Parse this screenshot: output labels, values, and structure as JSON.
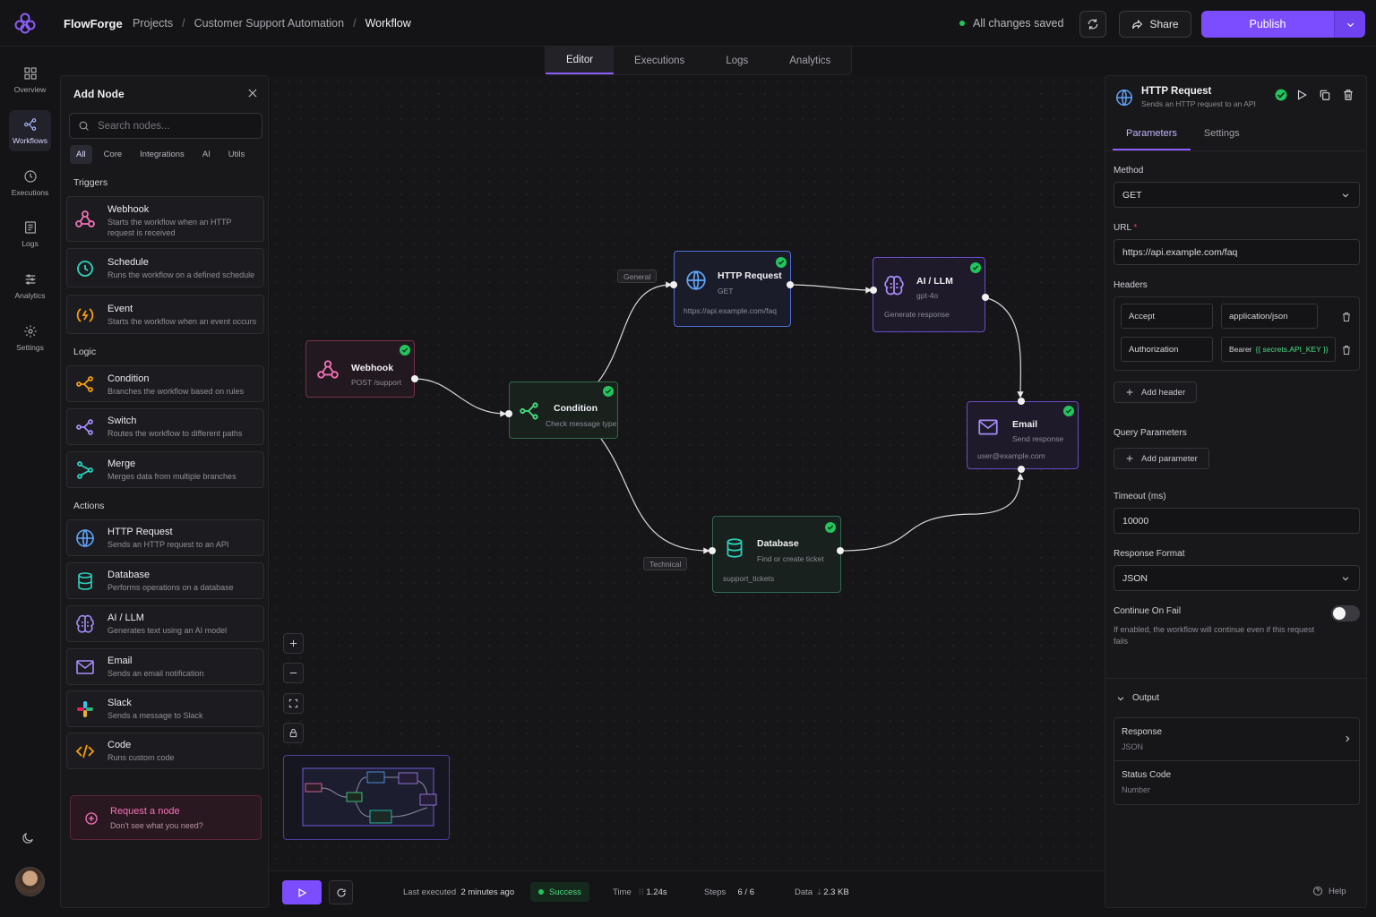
{
  "app": {
    "name": "FlowForge"
  },
  "breadcrumb": [
    "Projects",
    "Customer Support Automation",
    "Workflow"
  ],
  "header": {
    "status": "All changes saved",
    "share_label": "Share",
    "publish_label": "Publish"
  },
  "tabs": [
    "Editor",
    "Executions",
    "Logs",
    "Analytics"
  ],
  "rail": [
    {
      "label": "Overview",
      "icon": "grid-icon"
    },
    {
      "label": "Workflows",
      "icon": "workflow-icon"
    },
    {
      "label": "Executions",
      "icon": "clock-icon"
    },
    {
      "label": "Logs",
      "icon": "list-icon"
    },
    {
      "label": "Analytics",
      "icon": "bars-icon"
    },
    {
      "label": "Settings",
      "icon": "gear-icon"
    }
  ],
  "add_node": {
    "title": "Add Node",
    "search_placeholder": "Search nodes...",
    "filters": [
      "All",
      "Core",
      "Integrations",
      "AI",
      "Utils"
    ],
    "sections": {
      "triggers": "Triggers",
      "logic": "Logic",
      "actions": "Actions"
    },
    "triggers": [
      {
        "title": "Webhook",
        "desc": "Starts the workflow when an HTTP request is received"
      },
      {
        "title": "Schedule",
        "desc": "Runs the workflow on a defined schedule"
      },
      {
        "title": "Event",
        "desc": "Starts the workflow when an event occurs"
      }
    ],
    "logic": [
      {
        "title": "Condition",
        "desc": "Branches the workflow based on rules"
      },
      {
        "title": "Switch",
        "desc": "Routes the workflow to different paths"
      },
      {
        "title": "Merge",
        "desc": "Merges data from multiple branches"
      }
    ],
    "actions": [
      {
        "title": "HTTP Request",
        "desc": "Sends an HTTP request to an API"
      },
      {
        "title": "Database",
        "desc": "Performs operations on a database"
      },
      {
        "title": "AI / LLM",
        "desc": "Generates text using an AI model"
      },
      {
        "title": "Email",
        "desc": "Sends an email notification"
      },
      {
        "title": "Slack",
        "desc": "Sends a message to Slack"
      },
      {
        "title": "Code",
        "desc": "Runs custom code"
      }
    ],
    "request": {
      "title": "Request a node",
      "desc": "Don't see what you need?"
    }
  },
  "canvas": {
    "nodes": {
      "webhook": {
        "title": "Webhook",
        "sub": "POST /support"
      },
      "condition": {
        "title": "Condition",
        "sub": "Check message type"
      },
      "http": {
        "title": "HTTP Request",
        "sub": "GET",
        "extra": "https://api.example.com/faq"
      },
      "ai": {
        "title": "AI / LLM",
        "sub": "gpt-4o",
        "extra": "Generate response"
      },
      "email": {
        "title": "Email",
        "sub": "Send response",
        "extra": "user@example.com"
      },
      "database": {
        "title": "Database",
        "sub": "Find or create ticket",
        "extra": "support_tickets"
      }
    },
    "edge_labels": {
      "general": "General",
      "technical": "Technical"
    }
  },
  "bottom": {
    "last_label": "Last executed",
    "last_value": "2 minutes ago",
    "status": "Success",
    "time_label": "Time",
    "time_value": "1.24s",
    "steps_label": "Steps",
    "steps_value": "6 / 6",
    "data_label": "Data",
    "data_value": "2.3 KB"
  },
  "panel": {
    "title": "HTTP Request",
    "subtitle": "Sends an HTTP request to an API",
    "tabs": [
      "Parameters",
      "Settings"
    ],
    "method_label": "Method",
    "method_value": "GET",
    "url_label": "URL",
    "url_value": "https://api.example.com/faq",
    "headers_label": "Headers",
    "headers": [
      {
        "key": "Accept",
        "value": "application/json"
      },
      {
        "key": "Authorization",
        "value_prefix": "Bearer",
        "value_secret": "{{ secrets.API_KEY }}"
      }
    ],
    "add_header": "Add header",
    "query_label": "Query Parameters",
    "add_param": "Add parameter",
    "timeout_label": "Timeout (ms)",
    "timeout_value": "10000",
    "format_label": "Response Format",
    "format_value": "JSON",
    "cof_label": "Continue On Fail",
    "cof_desc": "If enabled, the workflow will continue even if this request fails",
    "cof_enabled": false,
    "output_label": "Output",
    "outputs": [
      {
        "title": "Response",
        "type": "JSON"
      },
      {
        "title": "Status Code",
        "type": "Number"
      }
    ],
    "help": "Help"
  },
  "colors": {
    "accent": "#7c4dff",
    "success": "#22c55e",
    "trigger": "#f472b6",
    "logic": "#8b5cf6",
    "action": "#60a5fa"
  }
}
